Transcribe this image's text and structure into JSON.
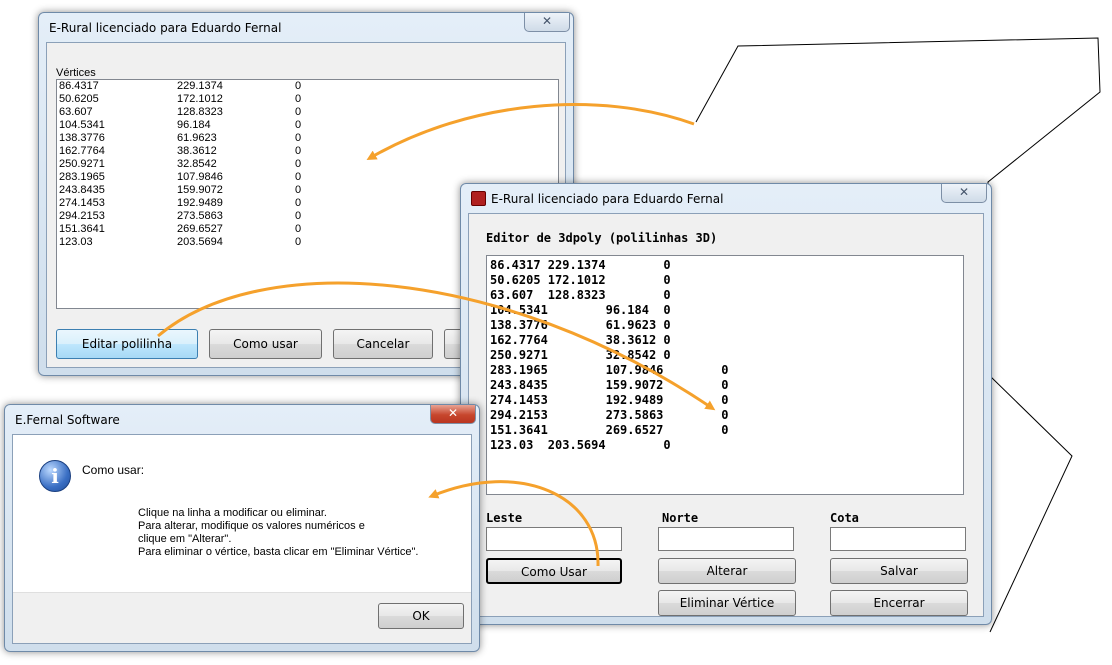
{
  "win1": {
    "title": "E-Rural licenciado para Eduardo Fernal",
    "close": "✕",
    "list_label": "Vértices",
    "rows": [
      {
        "x": "86.4317",
        "y": "229.1374",
        "z": "0"
      },
      {
        "x": "50.6205",
        "y": "172.1012",
        "z": "0"
      },
      {
        "x": "63.607",
        "y": "128.8323",
        "z": "0"
      },
      {
        "x": "104.5341",
        "y": "96.184",
        "z": "0"
      },
      {
        "x": "138.3776",
        "y": "61.9623",
        "z": "0"
      },
      {
        "x": "162.7764",
        "y": "38.3612",
        "z": "0"
      },
      {
        "x": "250.9271",
        "y": "32.8542",
        "z": "0"
      },
      {
        "x": "283.1965",
        "y": "107.9846",
        "z": "0"
      },
      {
        "x": "243.8435",
        "y": "159.9072",
        "z": "0"
      },
      {
        "x": "274.1453",
        "y": "192.9489",
        "z": "0"
      },
      {
        "x": "294.2153",
        "y": "273.5863",
        "z": "0"
      },
      {
        "x": "151.3641",
        "y": "269.6527",
        "z": "0"
      },
      {
        "x": "123.03",
        "y": "203.5694",
        "z": "0"
      }
    ],
    "buttons": {
      "editar": "Editar polilinha",
      "como_usar": "Como usar",
      "cancelar": "Cancelar"
    }
  },
  "win2": {
    "title": "E-Rural licenciado para Eduardo Fernal",
    "close": "✕",
    "heading": "Editor de 3dpoly (polilinhas 3D)",
    "lines": [
      "86.4317 229.1374        0",
      "50.6205 172.1012        0",
      "63.607  128.8323        0",
      "104.5341        96.184  0",
      "138.3776        61.9623 0",
      "162.7764        38.3612 0",
      "250.9271        32.8542 0",
      "283.1965        107.9846        0",
      "243.8435        159.9072        0",
      "274.1453        192.9489        0",
      "294.2153        273.5863        0",
      "151.3641        269.6527        0",
      "123.03  203.5694        0"
    ],
    "labels": {
      "leste": "Leste",
      "norte": "Norte",
      "cota": "Cota"
    },
    "buttons": {
      "como_usar": "Como Usar",
      "alterar": "Alterar",
      "salvar": "Salvar",
      "eliminar": "Eliminar Vértice",
      "encerrar": "Encerrar"
    }
  },
  "msg": {
    "title": "E.Fernal Software",
    "close": "✕",
    "info_glyph": "i",
    "heading": "Como usar:",
    "lines": [
      "Clique na linha a modificar ou eliminar.",
      "Para alterar, modifique os valores numéricos e",
      "clique em \"Alterar\".",
      "Para eliminar o vértice, basta clicar em \"Eliminar Vértice\"."
    ],
    "ok": "OK"
  },
  "colors": {
    "arrow": "#f5a12c",
    "accent": "#3b7fd4",
    "error": "#c7462d"
  }
}
